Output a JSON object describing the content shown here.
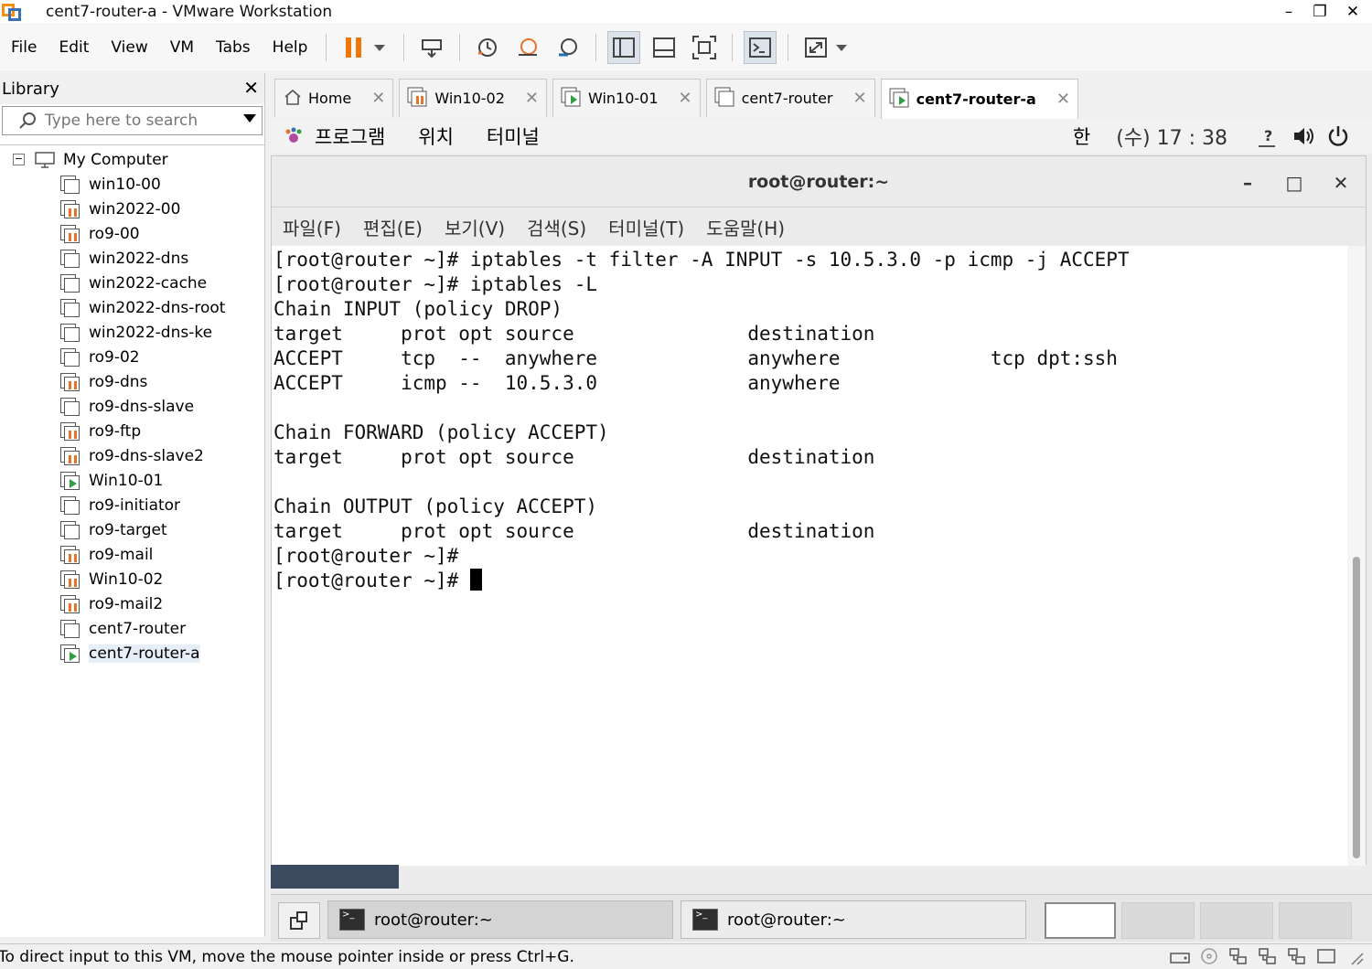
{
  "window": {
    "title": "cent7-router-a - VMware Workstation",
    "minimize": "–",
    "maximize": "❐",
    "close": "✕"
  },
  "menu": [
    "File",
    "Edit",
    "View",
    "VM",
    "Tabs",
    "Help"
  ],
  "library": {
    "title": "Library",
    "close": "✕",
    "search_placeholder": "Type here to search",
    "root": "My Computer",
    "items": [
      {
        "label": "win10-00",
        "state": "off"
      },
      {
        "label": "win2022-00",
        "state": "paused"
      },
      {
        "label": "ro9-00",
        "state": "paused"
      },
      {
        "label": "win2022-dns",
        "state": "off"
      },
      {
        "label": "win2022-cache",
        "state": "off"
      },
      {
        "label": "win2022-dns-root",
        "state": "off"
      },
      {
        "label": "win2022-dns-ke",
        "state": "off"
      },
      {
        "label": "ro9-02",
        "state": "off"
      },
      {
        "label": "ro9-dns",
        "state": "paused"
      },
      {
        "label": "ro9-dns-slave",
        "state": "off"
      },
      {
        "label": "ro9-ftp",
        "state": "paused"
      },
      {
        "label": "ro9-dns-slave2",
        "state": "paused"
      },
      {
        "label": "Win10-01",
        "state": "running"
      },
      {
        "label": "ro9-initiator",
        "state": "off"
      },
      {
        "label": "ro9-target",
        "state": "off"
      },
      {
        "label": "ro9-mail",
        "state": "paused"
      },
      {
        "label": "Win10-02",
        "state": "paused"
      },
      {
        "label": "ro9-mail2",
        "state": "paused"
      },
      {
        "label": "cent7-router",
        "state": "off"
      },
      {
        "label": "cent7-router-a",
        "state": "running"
      }
    ],
    "selected": "cent7-router-a"
  },
  "tabs": [
    {
      "label": "Home",
      "icon": "home-icon"
    },
    {
      "label": "Win10-02",
      "icon": "vm-paused-icon"
    },
    {
      "label": "Win10-01",
      "icon": "vm-running-icon"
    },
    {
      "label": "cent7-router",
      "icon": "vm-icon"
    },
    {
      "label": "cent7-router-a",
      "icon": "vm-running-icon",
      "active": true
    }
  ],
  "gnome": {
    "menus": [
      "프로그램",
      "위치",
      "터미널"
    ],
    "input_method": "한",
    "clock": "(수) 17 : 38"
  },
  "terminal": {
    "title": "root@router:~",
    "menus": [
      "파일(F)",
      "편집(E)",
      "보기(V)",
      "검색(S)",
      "터미널(T)",
      "도움말(H)"
    ],
    "lines": [
      "[root@router ~]# iptables -t filter -A INPUT -s 10.5.3.0 -p icmp -j ACCEPT",
      "[root@router ~]# iptables -L",
      "Chain INPUT (policy DROP)",
      "target     prot opt source               destination",
      "ACCEPT     tcp  --  anywhere             anywhere             tcp dpt:ssh",
      "ACCEPT     icmp --  10.5.3.0             anywhere",
      "",
      "Chain FORWARD (policy ACCEPT)",
      "target     prot opt source               destination",
      "",
      "Chain OUTPUT (policy ACCEPT)",
      "target     prot opt source               destination",
      "[root@router ~]#",
      "[root@router ~]# "
    ]
  },
  "taskbar": [
    {
      "label": "root@router:~"
    },
    {
      "label": "root@router:~"
    }
  ],
  "status": {
    "text": "To direct input to this VM, move the mouse pointer inside or press Ctrl+G."
  },
  "colors": {
    "pause_orange": "#f0780a",
    "run_green": "#2ea043",
    "accent_blue": "#3d6fb6"
  }
}
